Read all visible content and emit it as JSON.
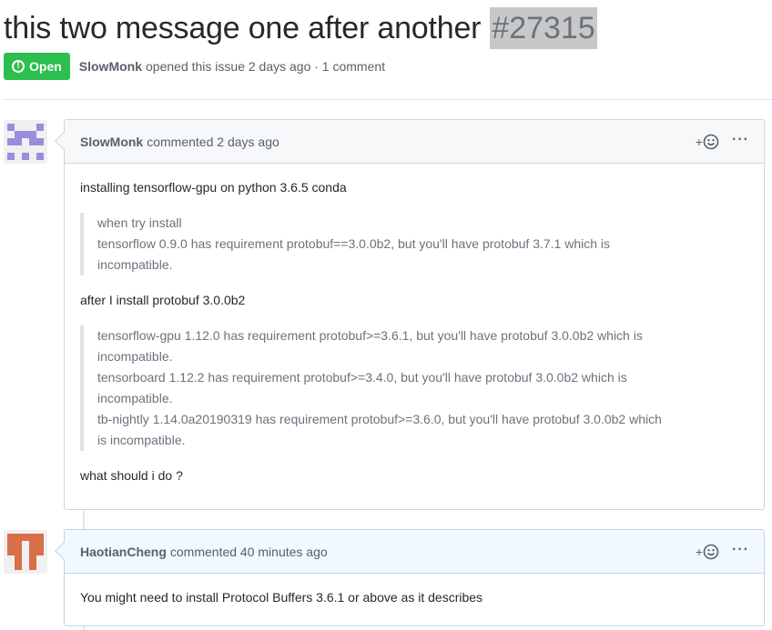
{
  "issue": {
    "title": "this two message one after another",
    "number": "#27315",
    "state": "Open",
    "state_color": "#2cbe4e",
    "author": "SlowMonk",
    "meta_action": "opened this issue 2 days ago · 1 comment"
  },
  "comments": [
    {
      "author": "SlowMonk",
      "action": "commented 2 days ago",
      "avatar_icon": "identicon-purple",
      "body": {
        "p1": "installing tensorflow-gpu on python 3.6.5 conda",
        "quote1": [
          "when try install",
          "tensorflow 0.9.0 has requirement protobuf==3.0.0b2, but you'll have protobuf 3.7.1 which is",
          "incompatible."
        ],
        "p2": "after I install protobuf 3.0.0b2",
        "quote2": [
          "tensorflow-gpu 1.12.0 has requirement protobuf>=3.6.1, but you'll have protobuf 3.0.0b2 which is",
          "incompatible.",
          "tensorboard 1.12.2 has requirement protobuf>=3.4.0, but you'll have protobuf 3.0.0b2 which is",
          "incompatible.",
          "tb-nightly 1.14.0a20190319 has requirement protobuf>=3.6.0, but you'll have protobuf 3.0.0b2 which",
          "is incompatible."
        ],
        "p3": "what should i do ?"
      }
    },
    {
      "author": "HaotianCheng",
      "action": "commented 40 minutes ago",
      "avatar_icon": "identicon-orange",
      "body": {
        "p1": "You might need to install Protocol Buffers 3.6.1 or above as it describes"
      }
    }
  ],
  "actions": {
    "reaction_icon": "smiley-plus-icon",
    "more_icon": "kebab-horizontal-icon",
    "more_label": "···",
    "plus_label": "+"
  }
}
